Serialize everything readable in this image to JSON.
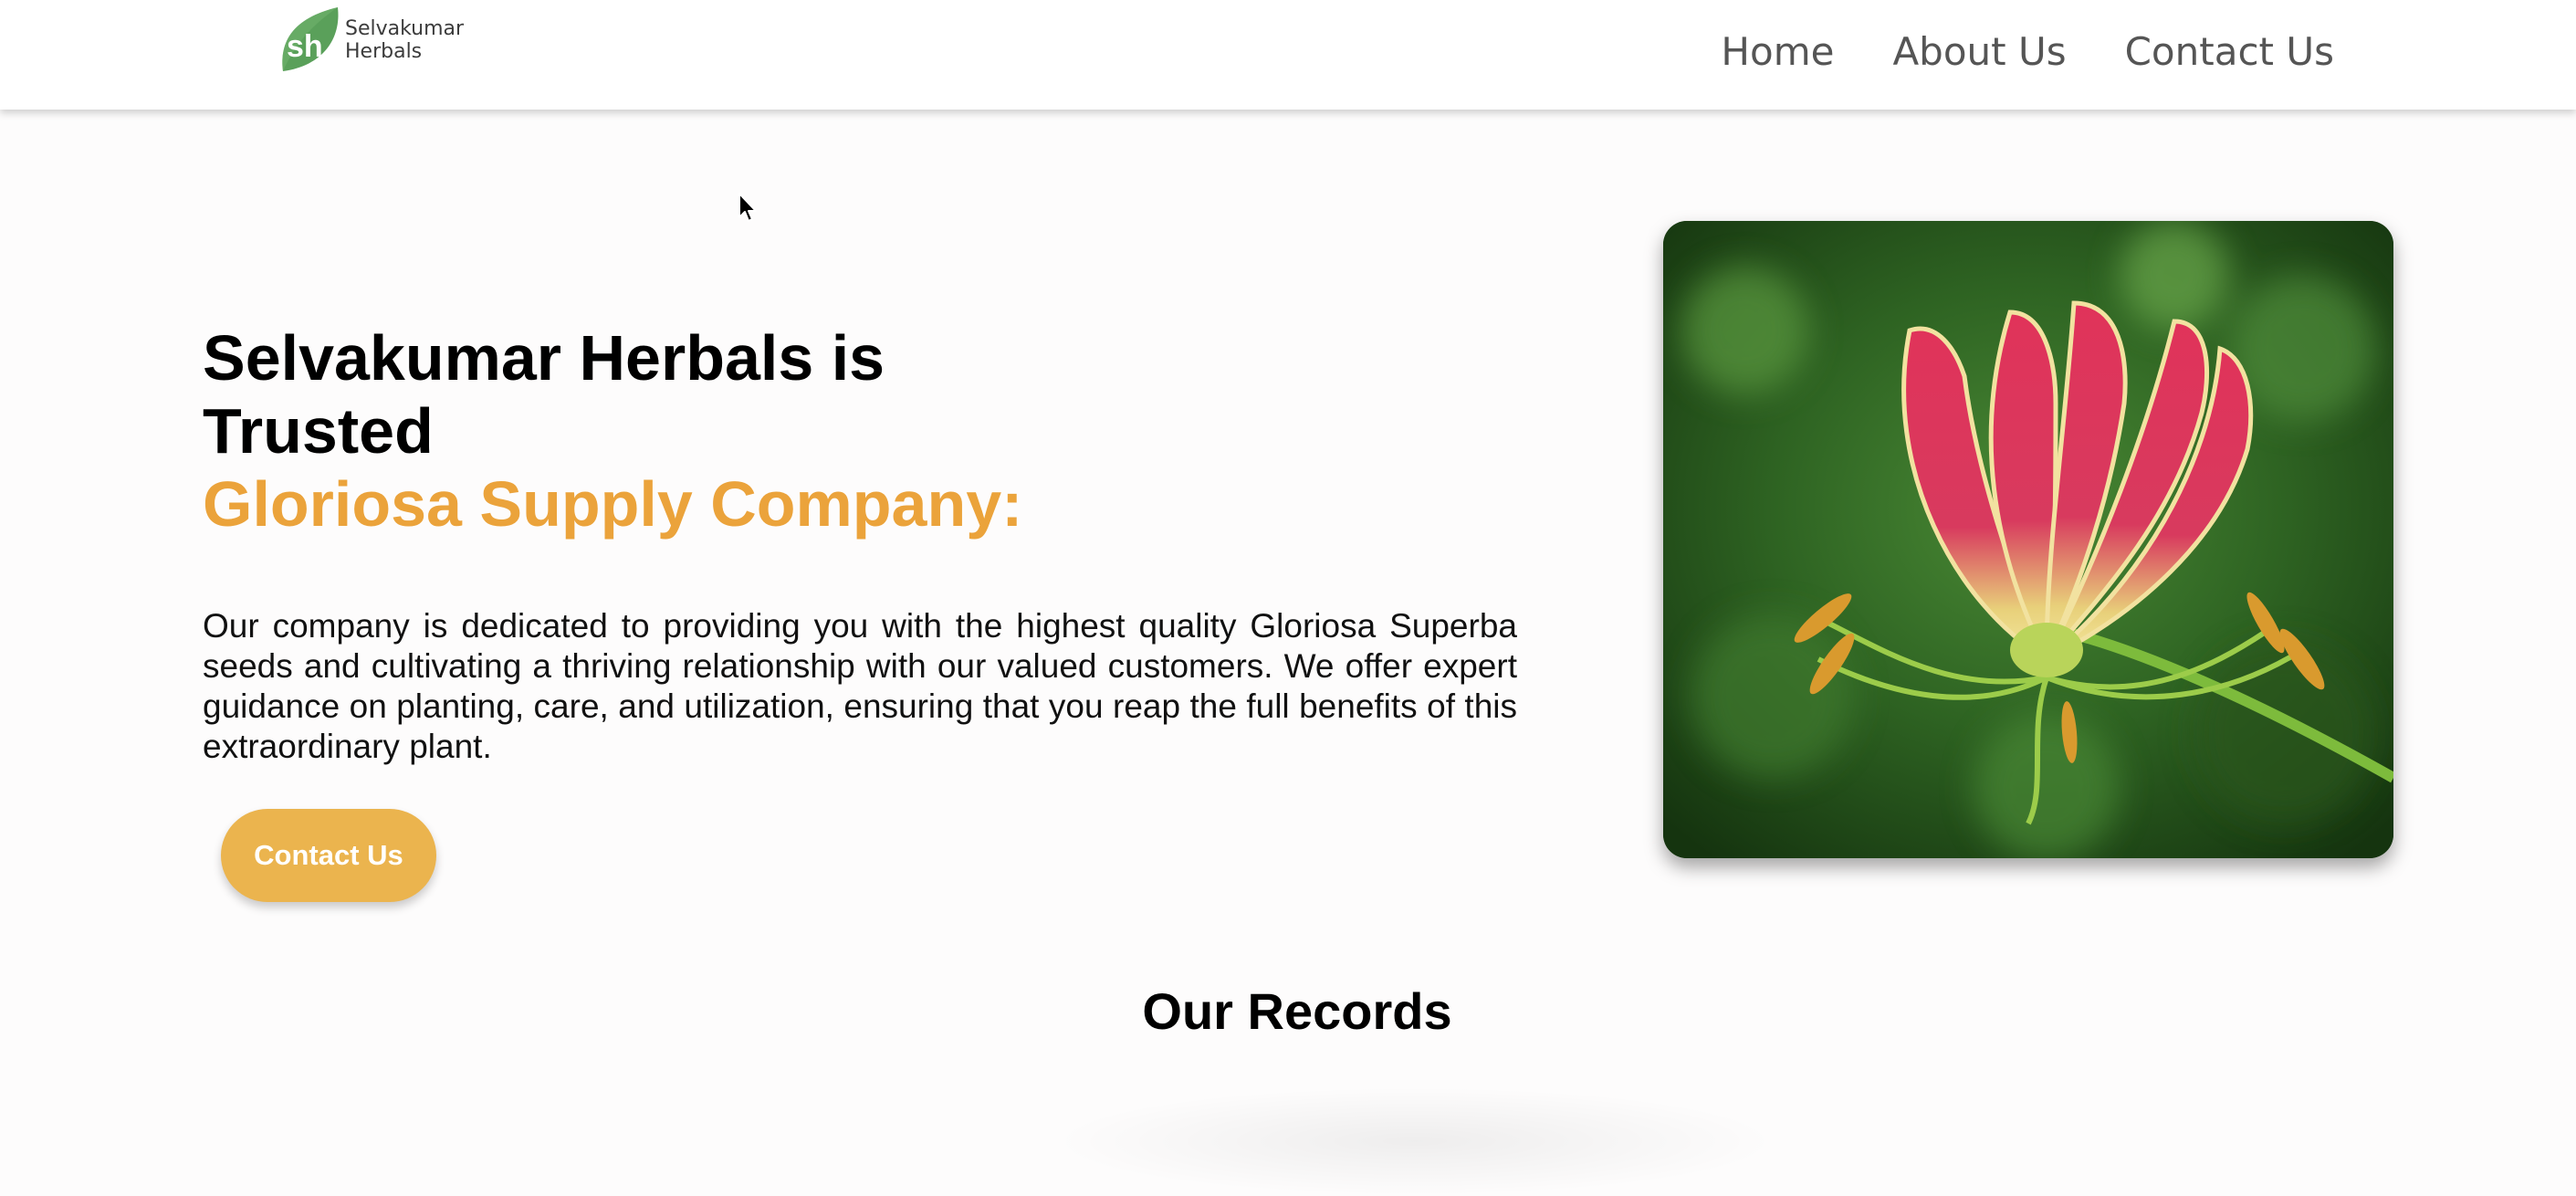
{
  "brand": {
    "logo_initials": "sh",
    "name_line1": "Selvakumar",
    "name_line2": "Herbals",
    "accent_color": "#5aa05a"
  },
  "nav": {
    "items": [
      {
        "label": "Home"
      },
      {
        "label": "About Us"
      },
      {
        "label": "Contact Us"
      }
    ]
  },
  "hero": {
    "title_line1": "Selvakumar Herbals is",
    "title_line2": "Trusted",
    "title_line3": "Gloriosa Supply Company:",
    "highlight_color": "#eba33b",
    "description": "Our company is dedicated to providing you with the highest quality Gloriosa Superba seeds and cultivating a thriving relationship with our valued customers. We offer expert guidance on planting, care, and utilization, ensuring that you reap the full benefits of this extraordinary plant.",
    "cta_label": "Contact Us",
    "cta_color": "#ebb44e",
    "image_subject": "gloriosa-lily-flower"
  },
  "records": {
    "heading": "Our Records"
  }
}
